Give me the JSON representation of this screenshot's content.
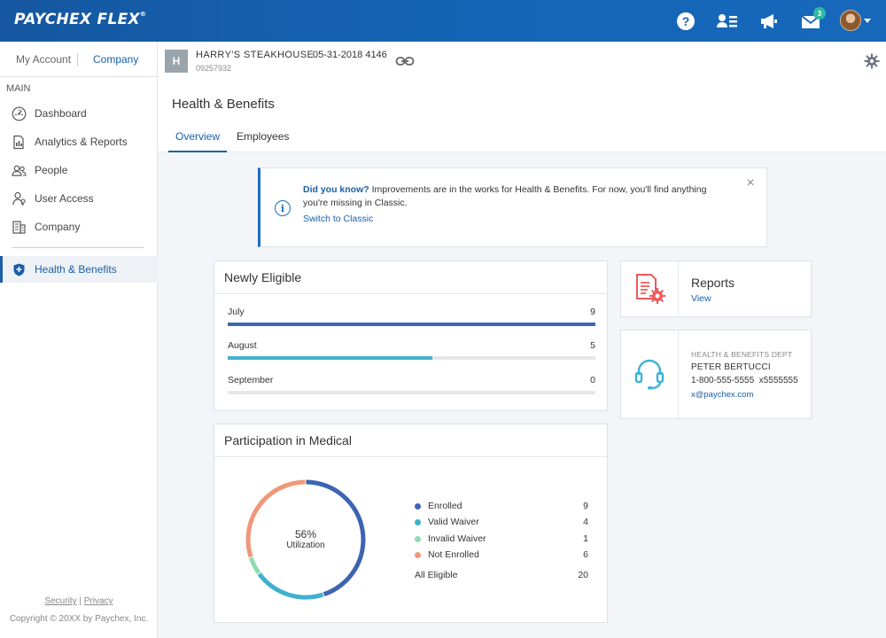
{
  "app": {
    "logo": "PAYCHEX FLEX",
    "logo_mark": "®",
    "notification_count": "3",
    "help_glyph": "?"
  },
  "sidebar": {
    "account_tabs": {
      "my_account": "My Account",
      "company": "Company"
    },
    "section": "MAIN",
    "items": [
      {
        "label": "Dashboard",
        "icon": "dashboard-icon"
      },
      {
        "label": "Analytics & Reports",
        "icon": "analytics-icon"
      },
      {
        "label": "People",
        "icon": "people-icon"
      },
      {
        "label": "User Access",
        "icon": "user-access-icon"
      },
      {
        "label": "Company",
        "icon": "company-icon"
      },
      {
        "label": "Health & Benefits",
        "icon": "shield-icon",
        "active": true
      }
    ],
    "footer": {
      "security": "Security",
      "separator": "|",
      "privacy": "Privacy",
      "copyright": "Copyright © 20XX by Paychex, Inc."
    }
  },
  "company": {
    "badge": "H",
    "name": "HARRY'S STEAKHOUSE",
    "date_code": "05-31-2018 4146",
    "id": "09257932"
  },
  "page": {
    "title": "Health & Benefits",
    "tabs": [
      {
        "label": "Overview",
        "active": true
      },
      {
        "label": "Employees",
        "active": false
      }
    ]
  },
  "banner": {
    "lead": "Did you know?",
    "message": " Improvements are in the works for Health & Benefits. For now, you'll find anything you're missing in Classic.",
    "link": "Switch to Classic",
    "close": "×",
    "info_glyph": "i"
  },
  "newly_eligible": {
    "title": "Newly Eligible",
    "max": 9,
    "rows": [
      {
        "month": "July",
        "count": 9,
        "color": "#3d64b0"
      },
      {
        "month": "August",
        "count": 5,
        "color": "#45b0cf"
      },
      {
        "month": "September",
        "count": 0,
        "color": "#45b0cf"
      }
    ]
  },
  "participation": {
    "title": "Participation in Medical",
    "utilization_pct": "56%",
    "utilization_label": "Utilization",
    "legend": [
      {
        "name": "Enrolled",
        "value": 9,
        "color": "#3d64b0"
      },
      {
        "name": "Valid Waiver",
        "value": 4,
        "color": "#3fb0cf"
      },
      {
        "name": "Invalid Waiver",
        "value": 1,
        "color": "#8fdcb1"
      },
      {
        "name": "Not Enrolled",
        "value": 6,
        "color": "#f0977a"
      }
    ],
    "total_label": "All Eligible",
    "total_value": "20"
  },
  "reports": {
    "title": "Reports",
    "link": "View"
  },
  "contact": {
    "dept": "HEALTH & BENEFITS DEPT",
    "name": "PETER BERTUCCI",
    "phone": "1-800-555-5555  x5555555",
    "email": "x@paychex.com"
  }
}
